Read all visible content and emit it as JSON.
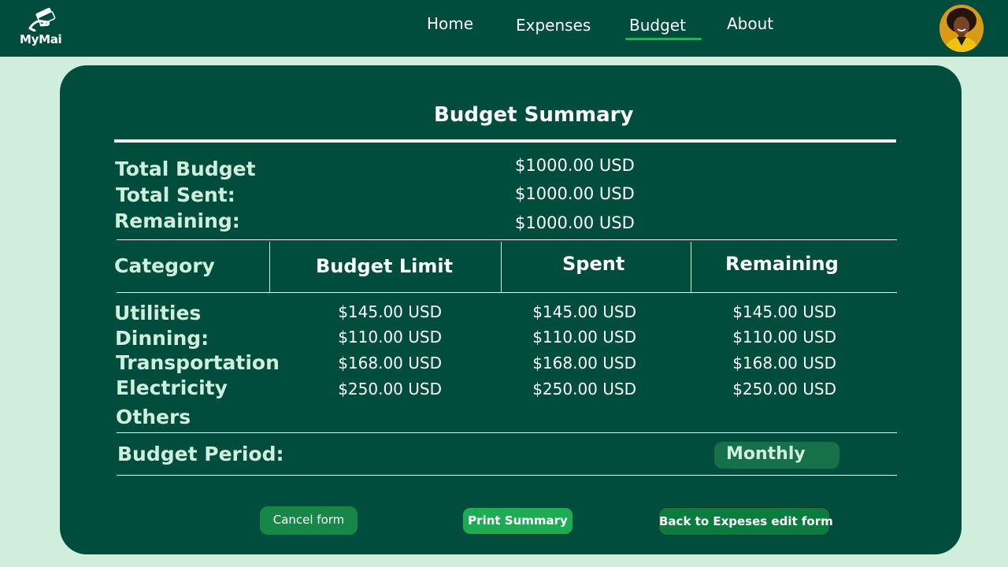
{
  "app": {
    "logo_text": "MyMai"
  },
  "nav": {
    "items": [
      {
        "label": "Home"
      },
      {
        "label": "Expenses"
      },
      {
        "label": "Budget"
      },
      {
        "label": "About"
      }
    ],
    "active": "Budget"
  },
  "summary": {
    "title": "Budget Summary",
    "totals": [
      {
        "label": "Total Budget",
        "value": "$1000.00 USD"
      },
      {
        "label": "Total Sent:",
        "value": "$1000.00 USD"
      },
      {
        "label": "Remaining:",
        "value": "$1000.00 USD"
      }
    ],
    "table": {
      "headers": [
        "Category",
        "Budget Limit",
        "Spent",
        "Remaining"
      ],
      "rows": [
        {
          "category": "Utilities",
          "limit": "$145.00 USD",
          "spent": "$145.00 USD",
          "remaining": "$145.00 USD"
        },
        {
          "category": "Dinning:",
          "limit": "$110.00 USD",
          "spent": "$110.00 USD",
          "remaining": "$110.00 USD"
        },
        {
          "category": "Transportation",
          "limit": "$168.00 USD",
          "spent": "$168.00 USD",
          "remaining": "$168.00 USD"
        },
        {
          "category": "Electricity",
          "limit": "$250.00 USD",
          "spent": "$250.00 USD",
          "remaining": "$250.00 USD"
        },
        {
          "category": "Others",
          "limit": "",
          "spent": "",
          "remaining": ""
        }
      ]
    },
    "period": {
      "label": "Budget Period:",
      "value": "Monthly"
    }
  },
  "buttons": {
    "cancel": "Cancel form",
    "print": "Print Summary",
    "back": "Back to Expeses edit form"
  },
  "colors": {
    "primary": "#004d3d",
    "background": "#cfeedb",
    "accent": "#2bb05e",
    "button_green": "#1dac53"
  }
}
